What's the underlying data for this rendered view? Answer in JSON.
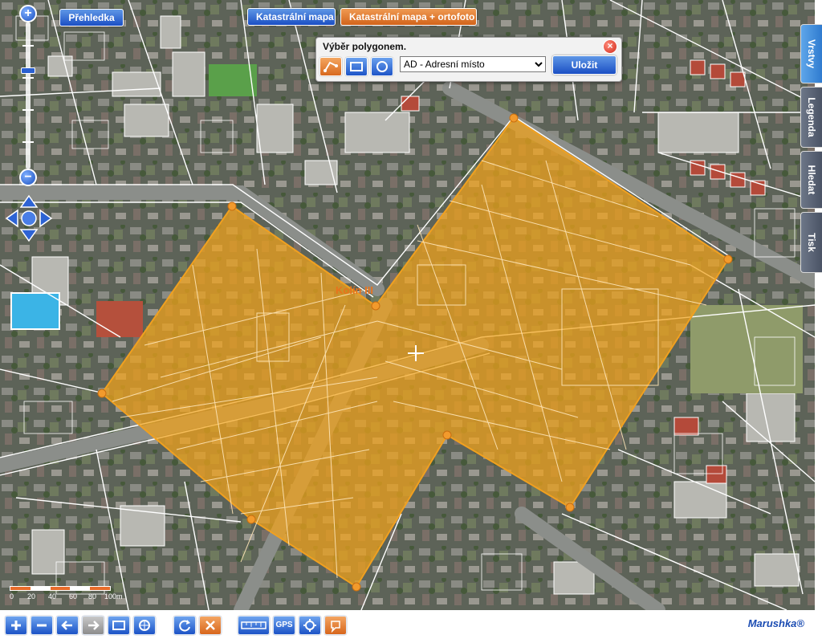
{
  "map": {
    "layer_buttons": [
      {
        "label": "Přehledka",
        "active": false
      },
      {
        "label": "Katastrální mapa",
        "active": false
      },
      {
        "label": "Katastrální mapa + ortofoto",
        "active": true
      }
    ],
    "place_labels": [
      "Kolín III"
    ],
    "scale_labels": [
      "0",
      "20",
      "40",
      "60",
      "80",
      "100m"
    ],
    "colors": {
      "polygon_fill": "#f2a31b",
      "polygon_stroke": "#f0a020",
      "vertex": "#f29a2c",
      "accent_blue": "#1b4fc4",
      "accent_orange": "#d2641b"
    }
  },
  "dialog": {
    "title": "Výběr polygonem.",
    "close_icon": "close-icon",
    "tools": [
      "draw-polygon-icon",
      "rectangle-select-icon",
      "circle-select-icon"
    ],
    "layer_options": [
      "AD - Adresní místo"
    ],
    "layer_selected": "AD - Adresní místo",
    "save_label": "Uložit"
  },
  "side_tabs": [
    {
      "label": "Vrstvy",
      "active": true
    },
    {
      "label": "Legenda",
      "active": false
    },
    {
      "label": "Hledat",
      "active": false
    },
    {
      "label": "Tisk",
      "active": false
    }
  ],
  "toolbar": {
    "gps_label": "GPS",
    "brand": "Marushka®",
    "icons": [
      "zoom-in-icon",
      "zoom-out-icon",
      "back-icon",
      "forward-icon",
      "zoom-rectangle-icon",
      "full-extent-icon",
      "refresh-icon",
      "clear-icon",
      "measure-icon",
      "gps-icon",
      "locate-icon",
      "info-icon"
    ]
  }
}
